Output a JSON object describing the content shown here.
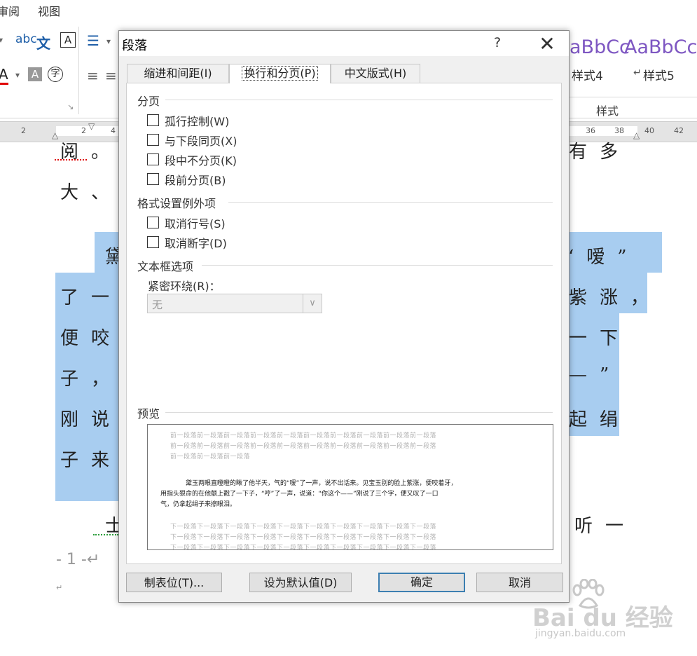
{
  "menu": {
    "review": "审阅",
    "view": "视图"
  },
  "ribbon": {
    "style_samples": [
      "aBbCc",
      "AaBbCc"
    ],
    "style_names": [
      "样式4",
      "样式5"
    ],
    "styles_group_label": "样式"
  },
  "ruler": {
    "left_nums": [
      "2",
      "2",
      "4"
    ],
    "right_nums": [
      "36",
      "38",
      "40",
      "42"
    ]
  },
  "document": {
    "lines": [
      {
        "left": "阅。",
        "right": "有多"
      },
      {
        "left": "大、",
        "right": ""
      },
      {
        "left": "黛",
        "right": "“嗳”"
      },
      {
        "left": "了一",
        "right": "紫涨，"
      },
      {
        "left": "便咬",
        "right": "一下"
      },
      {
        "left": "子，",
        "right": "—”"
      },
      {
        "left": "刚说",
        "right": "起绢"
      },
      {
        "left": "子来",
        "right": ""
      },
      {
        "left": "士",
        "right": "听一"
      }
    ],
    "page_number": "- 1 -↵",
    "para_mark": "↵"
  },
  "dialog": {
    "title": "段落",
    "help": "?",
    "close": "✕",
    "tabs": [
      {
        "label": "缩进和间距(I)",
        "active": false
      },
      {
        "label": "换行和分页(P)",
        "active": true
      },
      {
        "label": "中文版式(H)",
        "active": false
      }
    ],
    "pagination": {
      "title": "分页",
      "options": [
        {
          "label": "孤行控制(W)",
          "checked": false
        },
        {
          "label": "与下段同页(X)",
          "checked": false
        },
        {
          "label": "段中不分页(K)",
          "checked": false
        },
        {
          "label": "段前分页(B)",
          "checked": false
        }
      ]
    },
    "exceptions": {
      "title": "格式设置例外项",
      "options": [
        {
          "label": "取消行号(S)",
          "checked": false
        },
        {
          "label": "取消断字(D)",
          "checked": false
        }
      ]
    },
    "textbox": {
      "title": "文本框选项",
      "wrap_label": "紧密环绕(R)：",
      "wrap_value": "无"
    },
    "preview": {
      "title": "预览",
      "prev_lines": [
        "前一段落前一段落前一段落前一段落前一段落前一段落前一段落前一段落前一段落前一段落",
        "前一段落前一段落前一段落前一段落前一段落前一段落前一段落前一段落前一段落前一段落",
        "前一段落前一段落前一段落"
      ],
      "sample_lines": [
        "黛玉两眼直瞪瞪的瞅了他半天，气的“嗳”了一声，说不出话来。见宝玉别的脸上紫涨，便咬着牙，",
        "用指头狠命的在他额上戳了一下子，“哼”了一声，说道：“你这个——”刚说了三个字，便又叹了一口",
        "气，仍拿起绢子来擦眼泪。"
      ],
      "next_lines": [
        "下一段落下一段落下一段落下一段落下一段落下一段落下一段落下一段落下一段落下一段落",
        "下一段落下一段落下一段落下一段落下一段落下一段落下一段落下一段落下一段落下一段落",
        "下一段落下一段落下一段落下一段落下一段落下一段落下一段落下一段落下一段落下一段落"
      ]
    },
    "buttons": {
      "tabs": "制表位(T)...",
      "set_default": "设为默认值(D)",
      "ok": "确定",
      "cancel": "取消"
    }
  },
  "watermark": {
    "brand": "Bai du 经验",
    "url": "jingyan.baidu.com"
  }
}
